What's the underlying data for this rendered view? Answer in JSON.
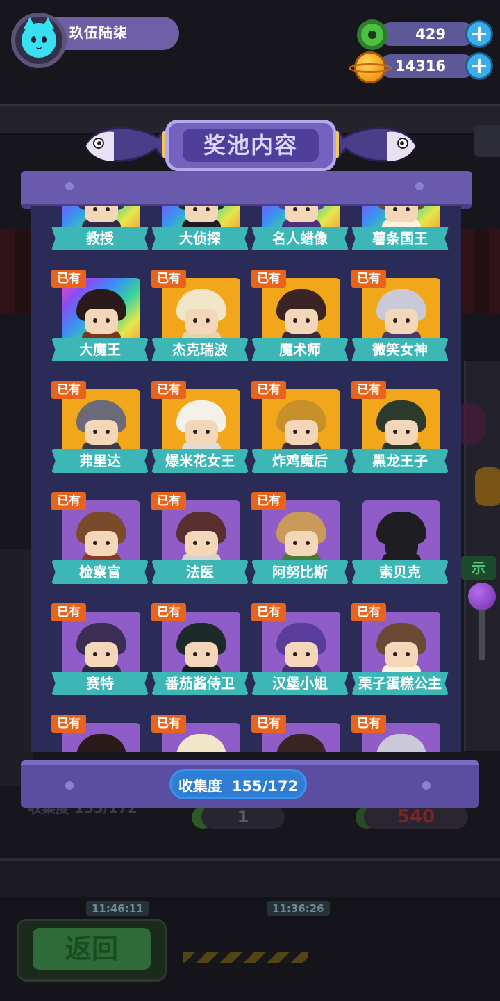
{
  "hud": {
    "username": "玖伍陆柒",
    "donut_count": "429",
    "coin_count": "14316",
    "plus_symbol": "+"
  },
  "panel": {
    "title": "奖池内容",
    "owned_badge": "已有",
    "collection_label": "收集度",
    "collection_value": "155/172"
  },
  "characters": [
    {
      "name": "教授",
      "owned": true,
      "frame": "rainbow"
    },
    {
      "name": "大侦探",
      "owned": true,
      "frame": "rainbow"
    },
    {
      "name": "名人蜡像",
      "owned": true,
      "frame": "rainbow"
    },
    {
      "name": "薯条国王",
      "owned": true,
      "frame": "rainbow"
    },
    {
      "name": "大魔王",
      "owned": true,
      "frame": "rainbow"
    },
    {
      "name": "杰克瑞波",
      "owned": true,
      "frame": "gold"
    },
    {
      "name": "魔术师",
      "owned": true,
      "frame": "gold"
    },
    {
      "name": "微笑女神",
      "owned": true,
      "frame": "gold"
    },
    {
      "name": "弗里达",
      "owned": true,
      "frame": "gold"
    },
    {
      "name": "爆米花女王",
      "owned": true,
      "frame": "gold"
    },
    {
      "name": "炸鸡魔后",
      "owned": true,
      "frame": "gold"
    },
    {
      "name": "黑龙王子",
      "owned": true,
      "frame": "gold"
    },
    {
      "name": "检察官",
      "owned": true,
      "frame": "purple"
    },
    {
      "name": "法医",
      "owned": true,
      "frame": "purple"
    },
    {
      "name": "阿努比斯",
      "owned": true,
      "frame": "purple"
    },
    {
      "name": "索贝克",
      "owned": false,
      "frame": "purple"
    },
    {
      "name": "赛特",
      "owned": true,
      "frame": "purple"
    },
    {
      "name": "番茄酱侍卫",
      "owned": true,
      "frame": "purple"
    },
    {
      "name": "汉堡小姐",
      "owned": true,
      "frame": "purple"
    },
    {
      "name": "栗子蛋糕公主",
      "owned": true,
      "frame": "purple"
    },
    {
      "name": "",
      "owned": true,
      "frame": "purple"
    },
    {
      "name": "",
      "owned": true,
      "frame": "purple"
    },
    {
      "name": "",
      "owned": true,
      "frame": "purple"
    },
    {
      "name": "",
      "owned": true,
      "frame": "purple"
    }
  ],
  "background": {
    "under_collection": "收集度 155/172",
    "under_coin_count": "1",
    "under_donut_count": "540",
    "return_button": "返回",
    "timer_1": "11:46:11",
    "timer_2": "11:36:26",
    "machine_button": "示"
  },
  "colors": {
    "panel": "#2a2b56",
    "label_tag": "#3cb7b6",
    "owned_badge": "#e8641c",
    "collection_pill": "#2f7ed6"
  }
}
